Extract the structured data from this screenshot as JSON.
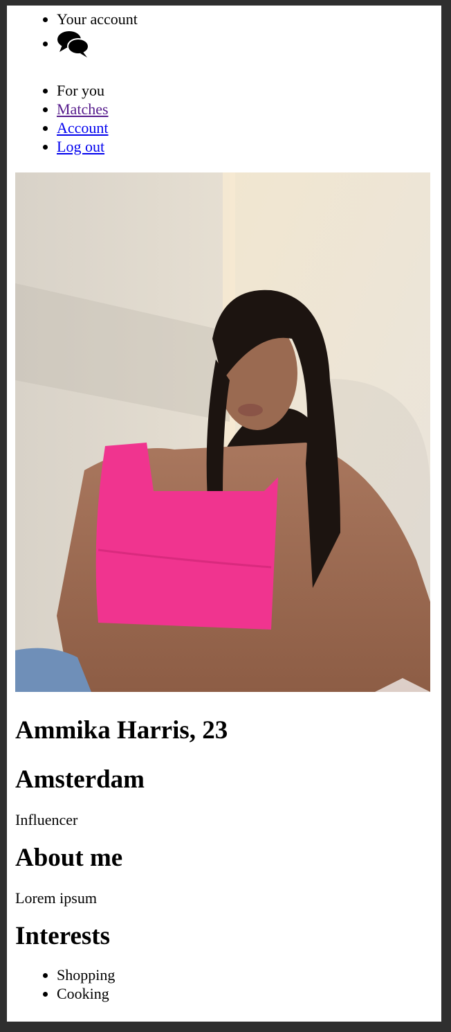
{
  "header": {
    "account_label": "Your account",
    "messages_icon": "chat-bubbles-icon"
  },
  "nav": {
    "items": [
      {
        "label": "For you",
        "link": false
      },
      {
        "label": "Matches",
        "link": true,
        "visited": true
      },
      {
        "label": "Account",
        "link": true
      },
      {
        "label": "Log out",
        "link": true
      }
    ]
  },
  "profile": {
    "photo": "profile-photo",
    "name_age": "Ammika Harris, 23",
    "city": "Amsterdam",
    "occupation": "Influencer",
    "about_heading": "About me",
    "about_text": "Lorem ipsum",
    "interests_heading": "Interests",
    "interests": [
      "Shopping",
      "Cooking"
    ]
  },
  "colors": {
    "link": "#0000ee",
    "link_visited": "#551a8b",
    "frame": "#2f2f2f",
    "top_pink": "#f0348f"
  }
}
